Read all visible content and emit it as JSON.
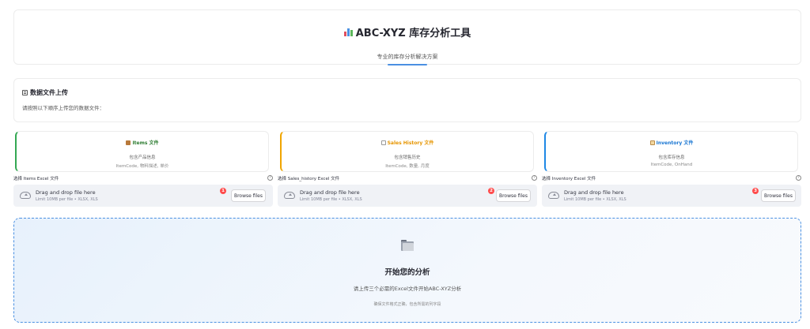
{
  "header": {
    "title": "ABC-XYZ 库存分析工具",
    "subtitle": "专业的库存分析解决方案",
    "accent_color": "#4a90e2"
  },
  "upload_section": {
    "title": "数据文件上传",
    "description": "请按照以下顺序上传您的数据文件："
  },
  "file_cards": [
    {
      "title": "Items 文件",
      "description": "包含产品信息",
      "fields": "ItemCode, 物料描述, 单价",
      "color": "#34a853"
    },
    {
      "title": "Sales History 文件",
      "description": "包含销售历史",
      "fields": "ItemCode, 数量, 月度",
      "color": "#f0a500"
    },
    {
      "title": "Inventory 文件",
      "description": "包含库存信息",
      "fields": "ItemCode, OnHand",
      "color": "#1e88e5"
    }
  ],
  "uploaders": [
    {
      "label": "选择 Items Excel 文件",
      "drag_text": "Drag and drop file here",
      "limit_text": "Limit 10MB per file • XLSX, XLS",
      "badge": "1",
      "button": "Browse files"
    },
    {
      "label": "选择 Sales_history Excel 文件",
      "drag_text": "Drag and drop file here",
      "limit_text": "Limit 10MB per file • XLSX, XLS",
      "badge": "2",
      "button": "Browse files"
    },
    {
      "label": "选择 Inventory Excel 文件",
      "drag_text": "Drag and drop file here",
      "limit_text": "Limit 10MB per file • XLSX, XLS",
      "badge": "3",
      "button": "Browse files"
    }
  ],
  "start_panel": {
    "title": "开始您的分析",
    "description": "请上传三个必需的Excel文件开始ABC-XYZ分析",
    "note": "确保文件格式正确，包含所需的列字段"
  },
  "icons": {
    "header": "bar-chart-icon",
    "section": "memo-icon",
    "items": "package-icon",
    "sales": "chart-up-icon",
    "inventory": "clipboard-icon",
    "dropzone": "cloud-upload-icon",
    "help": "help-circle-icon",
    "start": "folder-icon"
  },
  "colors": {
    "badge": "#ff4b4b",
    "dropzone_bg": "#f0f2f6",
    "panel_border": "#4a90e2"
  }
}
